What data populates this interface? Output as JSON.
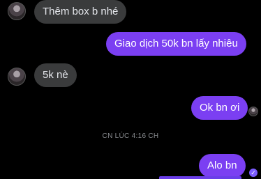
{
  "messages": [
    {
      "text": "Thêm box b nhé",
      "direction": "incoming"
    },
    {
      "text": "Giao dịch 50k bn lấy nhiêu",
      "direction": "outgoing"
    },
    {
      "text": "5k nè",
      "direction": "incoming"
    },
    {
      "text": "Ok bn ơi",
      "direction": "outgoing"
    },
    {
      "text": "Alo bn",
      "direction": "outgoing"
    }
  ],
  "timestamp": "CN LÚC 4:16 CH",
  "colors": {
    "outgoing_bubble": "#7b3ff2",
    "incoming_bubble": "#3a3b3c",
    "background": "#000000"
  },
  "icons": {
    "seen_receipt": "check-circle-icon",
    "avatar": "user-avatar-icon"
  }
}
